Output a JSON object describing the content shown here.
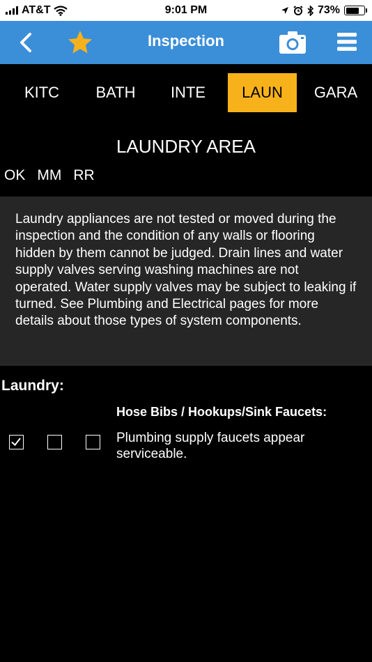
{
  "status_bar": {
    "carrier": "AT&T",
    "time": "9:01 PM",
    "battery_percent": "73%",
    "battery_level": 0.73
  },
  "nav": {
    "title": "Inspection"
  },
  "tabs": [
    {
      "label": "KITC",
      "active": false
    },
    {
      "label": "BATH",
      "active": false
    },
    {
      "label": "INTE",
      "active": false
    },
    {
      "label": "LAUN",
      "active": true
    },
    {
      "label": "GARA",
      "active": false
    }
  ],
  "section": {
    "title": "LAUNDRY AREA",
    "legend": [
      "OK",
      "MM",
      "RR"
    ],
    "description": "Laundry appliances are not tested or moved during the inspection and the condition of any walls or flooring hidden by them cannot be judged.  Drain lines and water supply valves serving washing machines are not operated.  Water supply valves may be subject to leaking if turned.  See Plumbing and Electrical pages for more details about those types of system components."
  },
  "group": {
    "title": "Laundry:",
    "item_heading": "Hose Bibs / Hookups/Sink Faucets:",
    "item_text": "Plumbing supply faucets appear serviceable.",
    "checkboxes": [
      {
        "label": "OK",
        "checked": true
      },
      {
        "label": "MM",
        "checked": false
      },
      {
        "label": "RR",
        "checked": false
      }
    ]
  },
  "colors": {
    "nav_blue": "#3b8ed8",
    "active_tab": "#f7b21b",
    "star": "#f7b21b",
    "info_bg": "#262626"
  }
}
